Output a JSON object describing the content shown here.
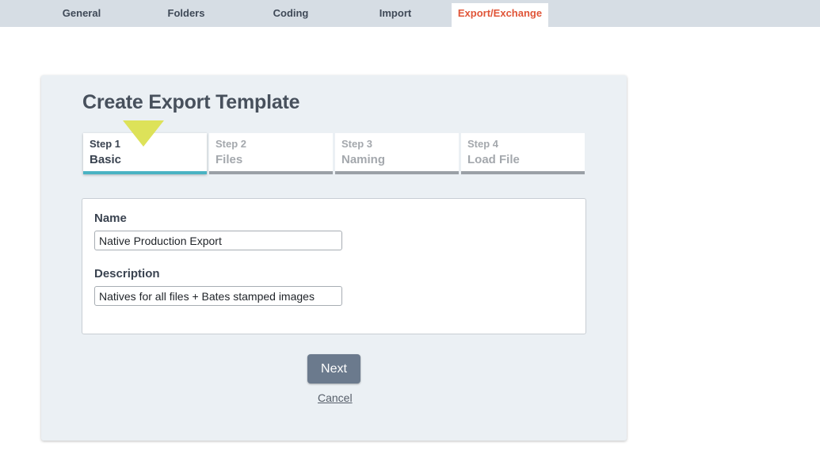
{
  "nav": {
    "tabs": [
      {
        "label": "General"
      },
      {
        "label": "Folders"
      },
      {
        "label": "Coding"
      },
      {
        "label": "Import"
      },
      {
        "label": "Export/Exchange",
        "active": true
      }
    ]
  },
  "card": {
    "title": "Create Export Template",
    "steps": [
      {
        "number": "Step 1",
        "name": "Basic",
        "active": true
      },
      {
        "number": "Step 2",
        "name": "Files"
      },
      {
        "number": "Step 3",
        "name": "Naming"
      },
      {
        "number": "Step 4",
        "name": "Load File"
      }
    ],
    "form": {
      "name_label": "Name",
      "name_value": "Native Production Export",
      "description_label": "Description",
      "description_value": "Natives for all files + Bates stamped images"
    },
    "next_label": "Next",
    "cancel_label": "Cancel"
  },
  "colors": {
    "active_tab_text": "#e05538",
    "active_step_underline": "#4ab3c3",
    "pointer": "#dde259",
    "next_button": "#6b7a8d"
  }
}
